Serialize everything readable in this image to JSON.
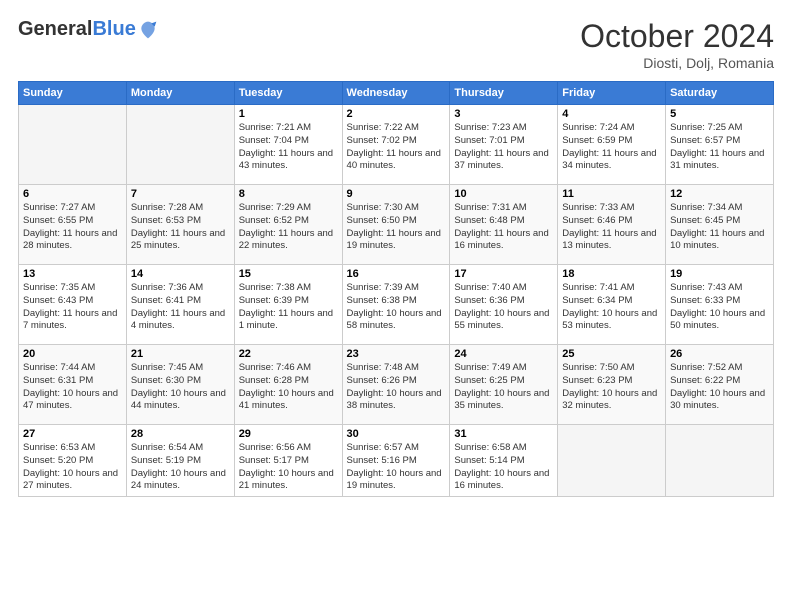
{
  "header": {
    "logo_general": "General",
    "logo_blue": "Blue",
    "month": "October 2024",
    "location": "Diosti, Dolj, Romania"
  },
  "weekdays": [
    "Sunday",
    "Monday",
    "Tuesday",
    "Wednesday",
    "Thursday",
    "Friday",
    "Saturday"
  ],
  "weeks": [
    [
      {
        "day": "",
        "info": ""
      },
      {
        "day": "",
        "info": ""
      },
      {
        "day": "1",
        "info": "Sunrise: 7:21 AM\nSunset: 7:04 PM\nDaylight: 11 hours and 43 minutes."
      },
      {
        "day": "2",
        "info": "Sunrise: 7:22 AM\nSunset: 7:02 PM\nDaylight: 11 hours and 40 minutes."
      },
      {
        "day": "3",
        "info": "Sunrise: 7:23 AM\nSunset: 7:01 PM\nDaylight: 11 hours and 37 minutes."
      },
      {
        "day": "4",
        "info": "Sunrise: 7:24 AM\nSunset: 6:59 PM\nDaylight: 11 hours and 34 minutes."
      },
      {
        "day": "5",
        "info": "Sunrise: 7:25 AM\nSunset: 6:57 PM\nDaylight: 11 hours and 31 minutes."
      }
    ],
    [
      {
        "day": "6",
        "info": "Sunrise: 7:27 AM\nSunset: 6:55 PM\nDaylight: 11 hours and 28 minutes."
      },
      {
        "day": "7",
        "info": "Sunrise: 7:28 AM\nSunset: 6:53 PM\nDaylight: 11 hours and 25 minutes."
      },
      {
        "day": "8",
        "info": "Sunrise: 7:29 AM\nSunset: 6:52 PM\nDaylight: 11 hours and 22 minutes."
      },
      {
        "day": "9",
        "info": "Sunrise: 7:30 AM\nSunset: 6:50 PM\nDaylight: 11 hours and 19 minutes."
      },
      {
        "day": "10",
        "info": "Sunrise: 7:31 AM\nSunset: 6:48 PM\nDaylight: 11 hours and 16 minutes."
      },
      {
        "day": "11",
        "info": "Sunrise: 7:33 AM\nSunset: 6:46 PM\nDaylight: 11 hours and 13 minutes."
      },
      {
        "day": "12",
        "info": "Sunrise: 7:34 AM\nSunset: 6:45 PM\nDaylight: 11 hours and 10 minutes."
      }
    ],
    [
      {
        "day": "13",
        "info": "Sunrise: 7:35 AM\nSunset: 6:43 PM\nDaylight: 11 hours and 7 minutes."
      },
      {
        "day": "14",
        "info": "Sunrise: 7:36 AM\nSunset: 6:41 PM\nDaylight: 11 hours and 4 minutes."
      },
      {
        "day": "15",
        "info": "Sunrise: 7:38 AM\nSunset: 6:39 PM\nDaylight: 11 hours and 1 minute."
      },
      {
        "day": "16",
        "info": "Sunrise: 7:39 AM\nSunset: 6:38 PM\nDaylight: 10 hours and 58 minutes."
      },
      {
        "day": "17",
        "info": "Sunrise: 7:40 AM\nSunset: 6:36 PM\nDaylight: 10 hours and 55 minutes."
      },
      {
        "day": "18",
        "info": "Sunrise: 7:41 AM\nSunset: 6:34 PM\nDaylight: 10 hours and 53 minutes."
      },
      {
        "day": "19",
        "info": "Sunrise: 7:43 AM\nSunset: 6:33 PM\nDaylight: 10 hours and 50 minutes."
      }
    ],
    [
      {
        "day": "20",
        "info": "Sunrise: 7:44 AM\nSunset: 6:31 PM\nDaylight: 10 hours and 47 minutes."
      },
      {
        "day": "21",
        "info": "Sunrise: 7:45 AM\nSunset: 6:30 PM\nDaylight: 10 hours and 44 minutes."
      },
      {
        "day": "22",
        "info": "Sunrise: 7:46 AM\nSunset: 6:28 PM\nDaylight: 10 hours and 41 minutes."
      },
      {
        "day": "23",
        "info": "Sunrise: 7:48 AM\nSunset: 6:26 PM\nDaylight: 10 hours and 38 minutes."
      },
      {
        "day": "24",
        "info": "Sunrise: 7:49 AM\nSunset: 6:25 PM\nDaylight: 10 hours and 35 minutes."
      },
      {
        "day": "25",
        "info": "Sunrise: 7:50 AM\nSunset: 6:23 PM\nDaylight: 10 hours and 32 minutes."
      },
      {
        "day": "26",
        "info": "Sunrise: 7:52 AM\nSunset: 6:22 PM\nDaylight: 10 hours and 30 minutes."
      }
    ],
    [
      {
        "day": "27",
        "info": "Sunrise: 6:53 AM\nSunset: 5:20 PM\nDaylight: 10 hours and 27 minutes."
      },
      {
        "day": "28",
        "info": "Sunrise: 6:54 AM\nSunset: 5:19 PM\nDaylight: 10 hours and 24 minutes."
      },
      {
        "day": "29",
        "info": "Sunrise: 6:56 AM\nSunset: 5:17 PM\nDaylight: 10 hours and 21 minutes."
      },
      {
        "day": "30",
        "info": "Sunrise: 6:57 AM\nSunset: 5:16 PM\nDaylight: 10 hours and 19 minutes."
      },
      {
        "day": "31",
        "info": "Sunrise: 6:58 AM\nSunset: 5:14 PM\nDaylight: 10 hours and 16 minutes."
      },
      {
        "day": "",
        "info": ""
      },
      {
        "day": "",
        "info": ""
      }
    ]
  ]
}
